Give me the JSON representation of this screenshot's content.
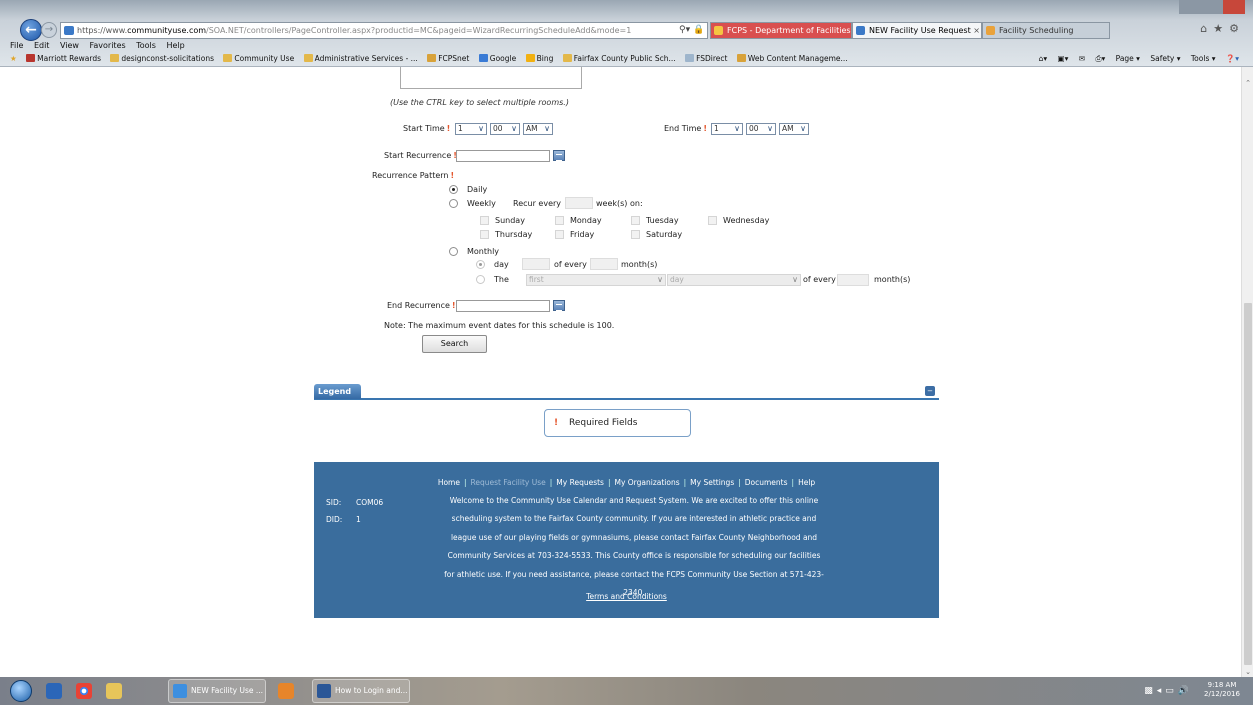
{
  "browser": {
    "address": {
      "protocol": "https://www.",
      "host": "communityuse.com",
      "path": "/SOA.NET/controllers/PageController.aspx?productid=MC&pageid=WizardRecurringScheduleAdd&mode=1"
    },
    "tabs": [
      {
        "label": "FCPS - Department of Facilities..."
      },
      {
        "label": "NEW Facility Use Request"
      },
      {
        "label": "Facility Scheduling"
      }
    ],
    "menu": [
      "File",
      "Edit",
      "View",
      "Favorites",
      "Tools",
      "Help"
    ],
    "favorites": [
      "Marriott Rewards",
      "designconst-solicitations",
      "Community Use",
      "Administrative Services - ...",
      "FCPSnet",
      "Google",
      "Bing",
      "Fairfax County Public Sch...",
      "FSDirect",
      "Web Content Manageme..."
    ],
    "command_bar": [
      "Page ▾",
      "Safety ▾",
      "Tools ▾"
    ]
  },
  "form": {
    "rooms_hint": "(Use the CTRL key to select multiple rooms.)",
    "start_time": {
      "label": "Start Time",
      "hour": "1",
      "minute": "00",
      "ampm": "AM"
    },
    "end_time": {
      "label": "End Time",
      "hour": "1",
      "minute": "00",
      "ampm": "AM"
    },
    "start_recurrence": {
      "label": "Start Recurrence"
    },
    "recurrence_pattern": {
      "label": "Recurrence Pattern",
      "daily": "Daily",
      "weekly": "Weekly",
      "recur_every": "Recur every",
      "weeks_on": "week(s) on:",
      "days": [
        "Sunday",
        "Monday",
        "Tuesday",
        "Wednesday",
        "Thursday",
        "Friday",
        "Saturday"
      ],
      "monthly": "Monthly",
      "day": "day",
      "of_every": "of every",
      "months": "month(s)",
      "the": "The",
      "ordinal_value": "first",
      "weekday_value": "day",
      "of_every_2": "of every",
      "months_2": "month(s)",
      "selected": "Daily"
    },
    "end_recurrence": {
      "label": "End Recurrence"
    },
    "note": "Note: The maximum event dates for this schedule is 100.",
    "search_button": "Search"
  },
  "legend": {
    "tab": "Legend",
    "required_mark": "!",
    "required_fields": "Required Fields"
  },
  "footer": {
    "nav": [
      "Home",
      "Request Facility Use",
      "My Requests",
      "My Organizations",
      "My Settings",
      "Documents",
      "Help"
    ],
    "sid_label": "SID:",
    "sid_value": "COM06",
    "did_label": "DID:",
    "did_value": "1",
    "lines": [
      "Welcome to the Community Use Calendar and Request System. We are excited to offer this online",
      "scheduling system to the Fairfax County community. If you are interested in athletic practice and",
      "league use of our playing fields or gymnasiums, please contact Fairfax County Neighborhood and",
      "Community Services at 703-324-5533. This County office is responsible for scheduling our facilities",
      "for athletic use. If you need assistance, please contact the FCPS Community Use Section at 571-423-",
      "2340."
    ],
    "terms": "Terms and Conditions"
  },
  "taskbar": {
    "buttons": [
      "NEW Facility Use ...",
      "How to Login and..."
    ],
    "time": "9:18 AM",
    "date": "2/12/2016"
  },
  "colors": {
    "footer_bg": "#3a6d9d",
    "required_mark": "#e4572e",
    "legend_tab": "#3469a4"
  }
}
